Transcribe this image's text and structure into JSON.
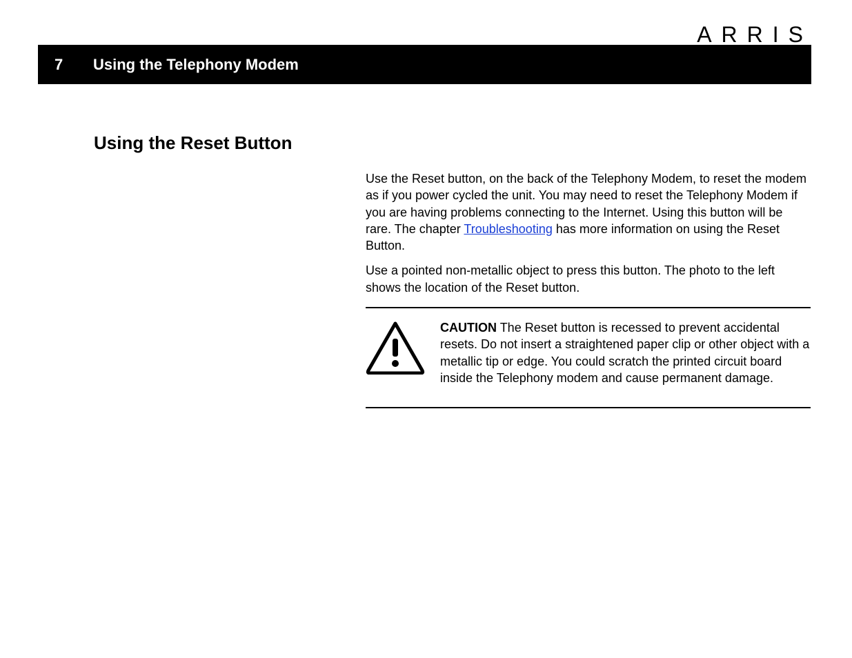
{
  "header": {
    "brand": "ARRIS",
    "page_number": "7",
    "page_title": "Using the Telephony Modem"
  },
  "section": {
    "heading": "Using the Reset Button"
  },
  "body": {
    "para1_a": "Use the Reset button, on the back of the Telephony Modem, to reset the modem as if you power cycled the unit. You may need to reset the Telephony Modem if you are having problems connecting to the Internet. Using this button will be rare. The chapter ",
    "link_text": "Troubleshooting",
    "para1_b": " has more information on using the Reset Button.",
    "para2": "Use a pointed non-metallic object to press this button. The photo to the left shows the location of the Reset button."
  },
  "caution": {
    "label": "CAUTION",
    "text": "The Reset button is recessed to prevent accidental resets. Do not insert a straightened paper clip or other object with a metallic tip or edge. You could scratch the printed circuit board inside the Telephony modem and cause permanent damage."
  }
}
